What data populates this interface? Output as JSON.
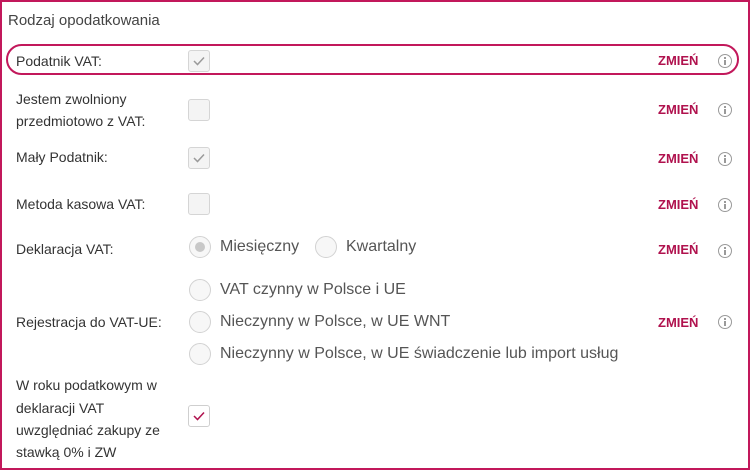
{
  "section_title": "Rodzaj opodatkowania",
  "change_label": "ZMIEŃ",
  "rows": {
    "vat_payer": {
      "label": "Podatnik VAT:",
      "checked": true
    },
    "exempt": {
      "label_line1": "Jestem zwolniony",
      "label_line2": "przedmiotowo z VAT:",
      "checked": false
    },
    "small_taxpayer": {
      "label": "Mały Podatnik:",
      "checked": true
    },
    "cash_method": {
      "label": "Metoda kasowa VAT:",
      "checked": false
    },
    "declaration": {
      "label": "Deklaracja VAT:",
      "options": [
        "Miesięczny",
        "Kwartalny"
      ],
      "selected": "Miesięczny"
    },
    "vat_ue": {
      "label": "Rejestracja do VAT-UE:",
      "options": [
        "VAT czynny w Polsce i UE",
        "Nieczynny w Polsce, w UE WNT",
        "Nieczynny w Polsce, w UE świadczenie lub import usług"
      ]
    },
    "zero_rate": {
      "label_lines": [
        "W roku podatkowym w",
        "deklaracji VAT",
        "uwzględniać zakupy ze",
        "stawką 0% i ZW"
      ],
      "checked": true
    }
  },
  "colors": {
    "accent": "#b0124e",
    "border": "#c2185b"
  }
}
